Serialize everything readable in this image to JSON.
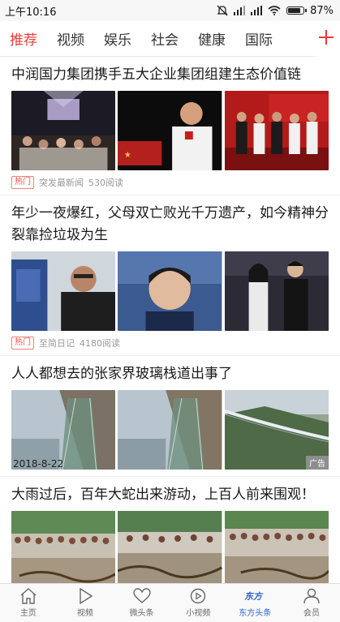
{
  "status": {
    "time": "上午10:16",
    "battery": "87%",
    "battery_level": 0.87
  },
  "tabs": [
    {
      "label": "推荐",
      "active": true
    },
    {
      "label": "视频"
    },
    {
      "label": "娱乐"
    },
    {
      "label": "社会"
    },
    {
      "label": "健康"
    },
    {
      "label": "国际"
    }
  ],
  "articles": [
    {
      "title": "中润国力集团携手五大企业集团组建生态价值链",
      "tag": "热门",
      "source": "突发最新闻",
      "reads": "530阅读"
    },
    {
      "title": "年少一夜爆红，父母双亡败光千万遗产，如今精神分裂靠捡垃圾为生",
      "tag": "热门",
      "source": "至简日记",
      "reads": "4180阅读"
    },
    {
      "title": "人人都想去的张家界玻璃栈道出事了",
      "date": "2018-8-22",
      "ad": "广告"
    },
    {
      "title": "大雨过后，百年大蛇出来游动，上百人前来围观！"
    }
  ],
  "bottom_nav": [
    {
      "label": "主页",
      "icon": "home-icon"
    },
    {
      "label": "视频",
      "icon": "play-icon"
    },
    {
      "label": "微头条",
      "icon": "heart-icon"
    },
    {
      "label": "小视频",
      "icon": "small-video-icon"
    },
    {
      "label": "东方头条",
      "icon": "brand-icon",
      "active": true
    },
    {
      "label": "会员",
      "icon": "person-icon"
    }
  ],
  "colors": {
    "accent": "#e93a3a",
    "nav_active": "#2c63c9"
  }
}
